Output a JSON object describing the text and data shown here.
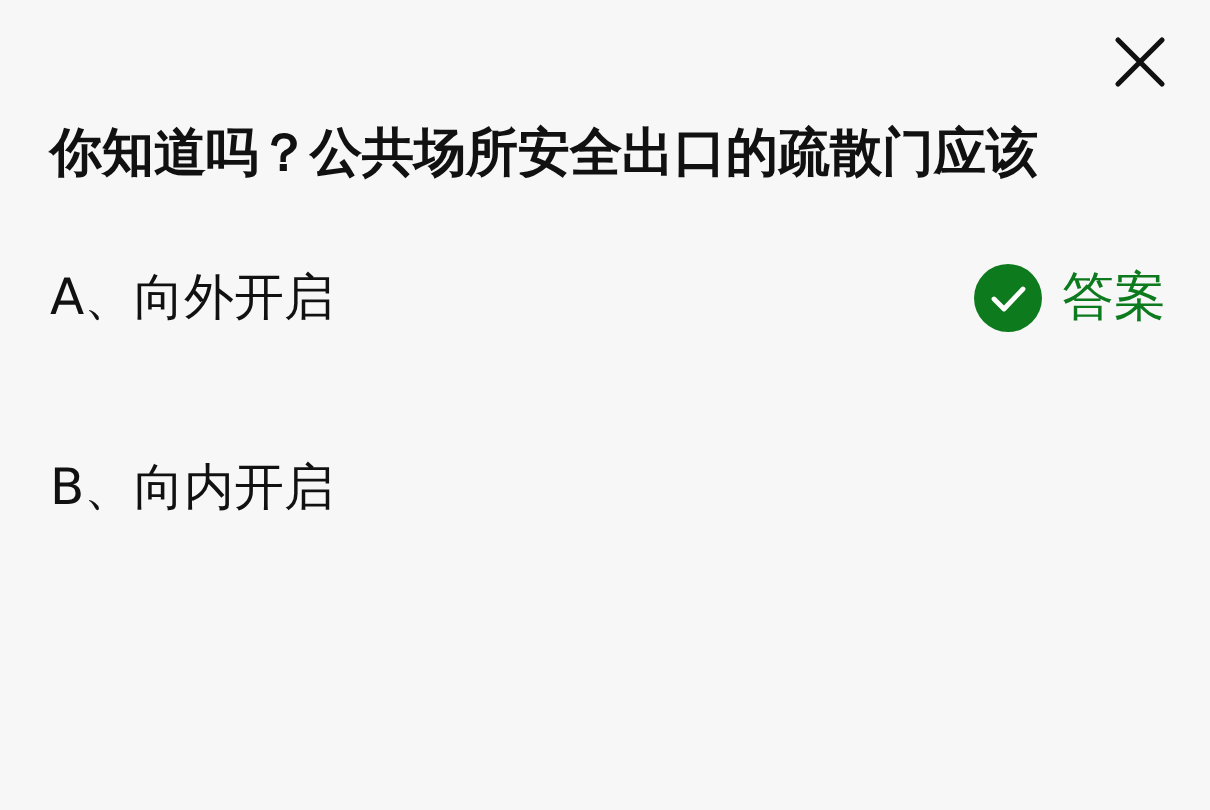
{
  "question": "你知道吗？公共场所安全出口的疏散门应该",
  "options": [
    {
      "label": "A、向外开启",
      "correct": true
    },
    {
      "label": "B、向内开启",
      "correct": false
    }
  ],
  "answer_label": "答案"
}
